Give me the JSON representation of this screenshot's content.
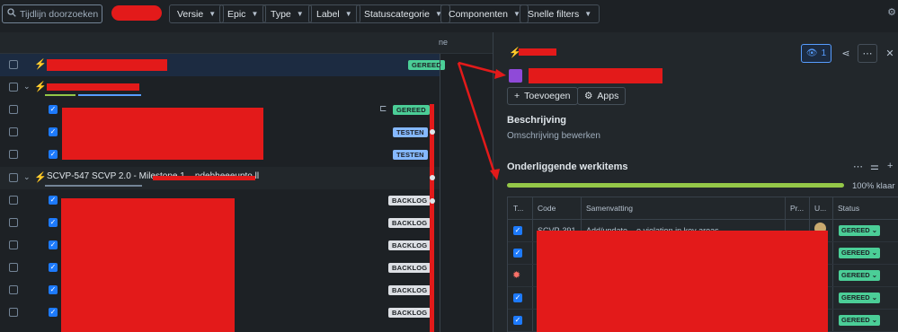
{
  "topbar": {
    "search_placeholder": "Tijdlijn doorzoeken",
    "filters": [
      "Versie",
      "Epic",
      "Type",
      "Label",
      "Statuscategorie",
      "Componenten",
      "Snelle filters"
    ]
  },
  "timeline": {
    "column_label": "ne",
    "rows": [
      {
        "kind": "epic",
        "status": "GEREED",
        "selected": true
      },
      {
        "kind": "epic-parent",
        "status": ""
      },
      {
        "kind": "task",
        "status": "GEREED"
      },
      {
        "kind": "task",
        "status": "TESTEN"
      },
      {
        "kind": "task",
        "status": "TESTEN"
      },
      {
        "kind": "epic-parent",
        "status": "",
        "text": "SCVP-547 SCVP 2.0 - Milestone 1 ...ndehheeeupto.ll"
      },
      {
        "kind": "task",
        "status": "BACKLOG"
      },
      {
        "kind": "task",
        "status": "BACKLOG"
      },
      {
        "kind": "task",
        "status": "BACKLOG"
      },
      {
        "kind": "task",
        "status": "BACKLOG"
      },
      {
        "kind": "task",
        "status": "BACKLOG"
      },
      {
        "kind": "task",
        "status": "BACKLOG"
      }
    ]
  },
  "detail": {
    "watch_count": "1",
    "add_label": "Toevoegen",
    "apps_label": "Apps",
    "description_heading": "Beschrijving",
    "description_placeholder": "Omschrijving bewerken",
    "children_heading": "Onderliggende werkitems",
    "progress_label": "100% klaar",
    "progress_value": 1.0,
    "table": {
      "headers": [
        "T...",
        "Code",
        "Samenvatting",
        "Pr...",
        "U...",
        "Status"
      ],
      "rows": [
        {
          "type": "task",
          "code": "SCVP-391",
          "summary": "Add/update ...e violation in key areas",
          "status": "GEREED"
        },
        {
          "type": "task",
          "code": "",
          "summary": "",
          "status": "GEREED"
        },
        {
          "type": "bug",
          "code": "",
          "summary": "",
          "status": "GEREED"
        },
        {
          "type": "task",
          "code": "",
          "summary": "",
          "status": "GEREED"
        },
        {
          "type": "task",
          "code": "",
          "summary": "",
          "status": "GEREED"
        }
      ]
    }
  },
  "colors": {
    "background": "#1d2125",
    "panel": "#22272b",
    "accent": "#579dff",
    "done": "#4bce97",
    "testing": "#85b8ff",
    "progress": "#94c748",
    "annotation": "#e31a1a"
  }
}
